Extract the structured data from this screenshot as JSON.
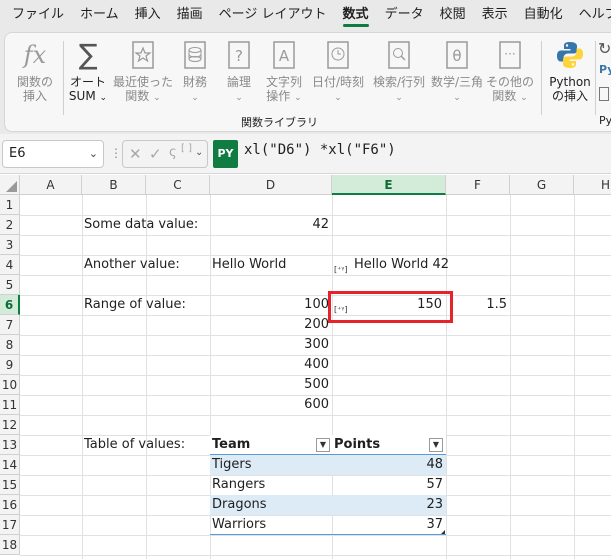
{
  "menu": {
    "tabs": [
      "ファイル",
      "ホーム",
      "挿入",
      "描画",
      "ページ レイアウト",
      "数式",
      "データ",
      "校閲",
      "表示",
      "自動化",
      "ヘルプ"
    ],
    "active_tab": "数式"
  },
  "ribbon": {
    "insert_function": {
      "line1": "関数の",
      "line2": "挿入"
    },
    "autosum": {
      "line1": "オート",
      "line2": "SUM"
    },
    "recent": {
      "line1": "最近使った",
      "line2": "関数"
    },
    "financial": {
      "line1": "財務",
      "line2": ""
    },
    "logical": {
      "line1": "論理",
      "line2": ""
    },
    "text": {
      "line1": "文字列",
      "line2": "操作"
    },
    "datetime": {
      "line1": "日付/時刻",
      "line2": ""
    },
    "lookup": {
      "line1": "検索/行列",
      "line2": ""
    },
    "math": {
      "line1": "数学/三角",
      "line2": ""
    },
    "more": {
      "line1": "その他の",
      "line2": "関数"
    },
    "python": {
      "line1": "Python",
      "line2": "の挿入"
    },
    "group_label": "関数ライブラリ",
    "partial_label": "Py"
  },
  "formula_bar": {
    "name_box": "E6",
    "py_badge": "PY",
    "formula": "xl(\"D6\") *xl(\"F6\")"
  },
  "columns": [
    "A",
    "B",
    "C",
    "D",
    "E",
    "F",
    "G",
    "H"
  ],
  "rows": [
    "1",
    "2",
    "3",
    "4",
    "5",
    "6",
    "7",
    "8",
    "9",
    "10",
    "11",
    "12",
    "13",
    "14",
    "15",
    "16",
    "17",
    "18"
  ],
  "selected": {
    "column": "E",
    "row": "6"
  },
  "cells": {
    "B2": "Some data value:",
    "D2": "42",
    "B4": "Another value:",
    "D4": "Hello World",
    "E4": "Hello World 42",
    "B6": "Range of value:",
    "D6": "100",
    "E6": "150",
    "F6": "1.5",
    "D7": "200",
    "D8": "300",
    "D9": "400",
    "D10": "500",
    "D11": "600",
    "B13": "Table of values:"
  },
  "table": {
    "headers": [
      "Team",
      "Points"
    ],
    "rows": [
      {
        "team": "Tigers",
        "points": "48"
      },
      {
        "team": "Rangers",
        "points": "57"
      },
      {
        "team": "Dragons",
        "points": "23"
      },
      {
        "team": "Warriors",
        "points": "37"
      }
    ]
  },
  "colors": {
    "accent": "#107c41",
    "selection_highlight": "#e4232a",
    "table_band": "#ddebf7"
  }
}
